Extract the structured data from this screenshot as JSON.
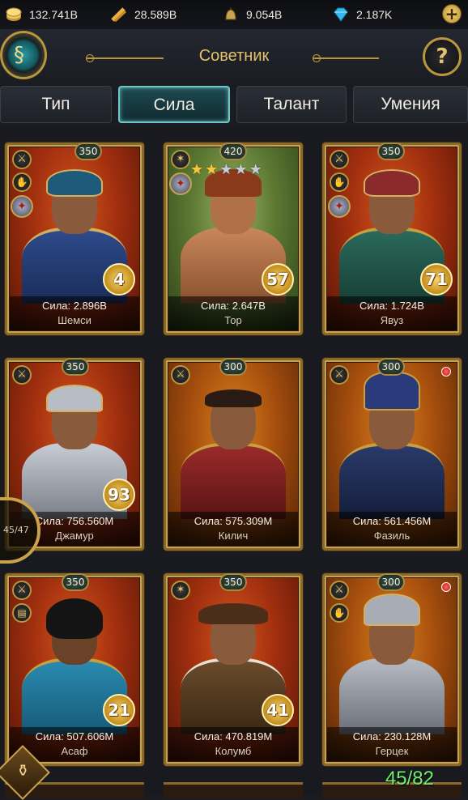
{
  "resources": [
    {
      "icon": "coin-icon",
      "value": "132.741B"
    },
    {
      "icon": "grain-icon",
      "value": "28.589B"
    },
    {
      "icon": "soldier-helmet-icon",
      "value": "9.054B"
    },
    {
      "icon": "diamond-icon",
      "value": "2.187K"
    }
  ],
  "header": {
    "title": "Советник",
    "help_glyph": "?"
  },
  "tabs": [
    {
      "label": "Тип",
      "active": false
    },
    {
      "label": "Сила",
      "active": true
    },
    {
      "label": "Талант",
      "active": false
    },
    {
      "label": "Умения",
      "active": false
    }
  ],
  "advisors": [
    {
      "name": "Шемси",
      "power": "Сила: 2.896B",
      "level": "350",
      "badge": "4",
      "stars": 0,
      "red_dot": false
    },
    {
      "name": "Тор",
      "power": "Сила: 2.647B",
      "level": "420",
      "badge": "57",
      "stars": 2,
      "red_dot": false
    },
    {
      "name": "Явуз",
      "power": "Сила: 1.724B",
      "level": "350",
      "badge": "71",
      "stars": 0,
      "red_dot": false
    },
    {
      "name": "Джамур",
      "power": "Сила: 756.560M",
      "level": "350",
      "badge": "93",
      "stars": 0,
      "red_dot": false
    },
    {
      "name": "Килич",
      "power": "Сила: 575.309M",
      "level": "300",
      "badge": "",
      "stars": 0,
      "red_dot": false
    },
    {
      "name": "Фазиль",
      "power": "Сила: 561.456M",
      "level": "300",
      "badge": "",
      "stars": 0,
      "red_dot": true
    },
    {
      "name": "Асаф",
      "power": "Сила: 507.606M",
      "level": "350",
      "badge": "21",
      "stars": 0,
      "red_dot": false
    },
    {
      "name": "Колумб",
      "power": "Сила: 470.819M",
      "level": "350",
      "badge": "41",
      "stars": 0,
      "red_dot": false
    },
    {
      "name": "Герцек",
      "power": "Сила: 230.128M",
      "level": "300",
      "badge": "",
      "stars": 0,
      "red_dot": true
    }
  ],
  "overlay_counter": "45/47",
  "total_count": "45/82",
  "colors": {
    "accent_gold": "#e2c26a",
    "active_tab": "#6fc6c6",
    "count_green": "#6ef06a"
  }
}
